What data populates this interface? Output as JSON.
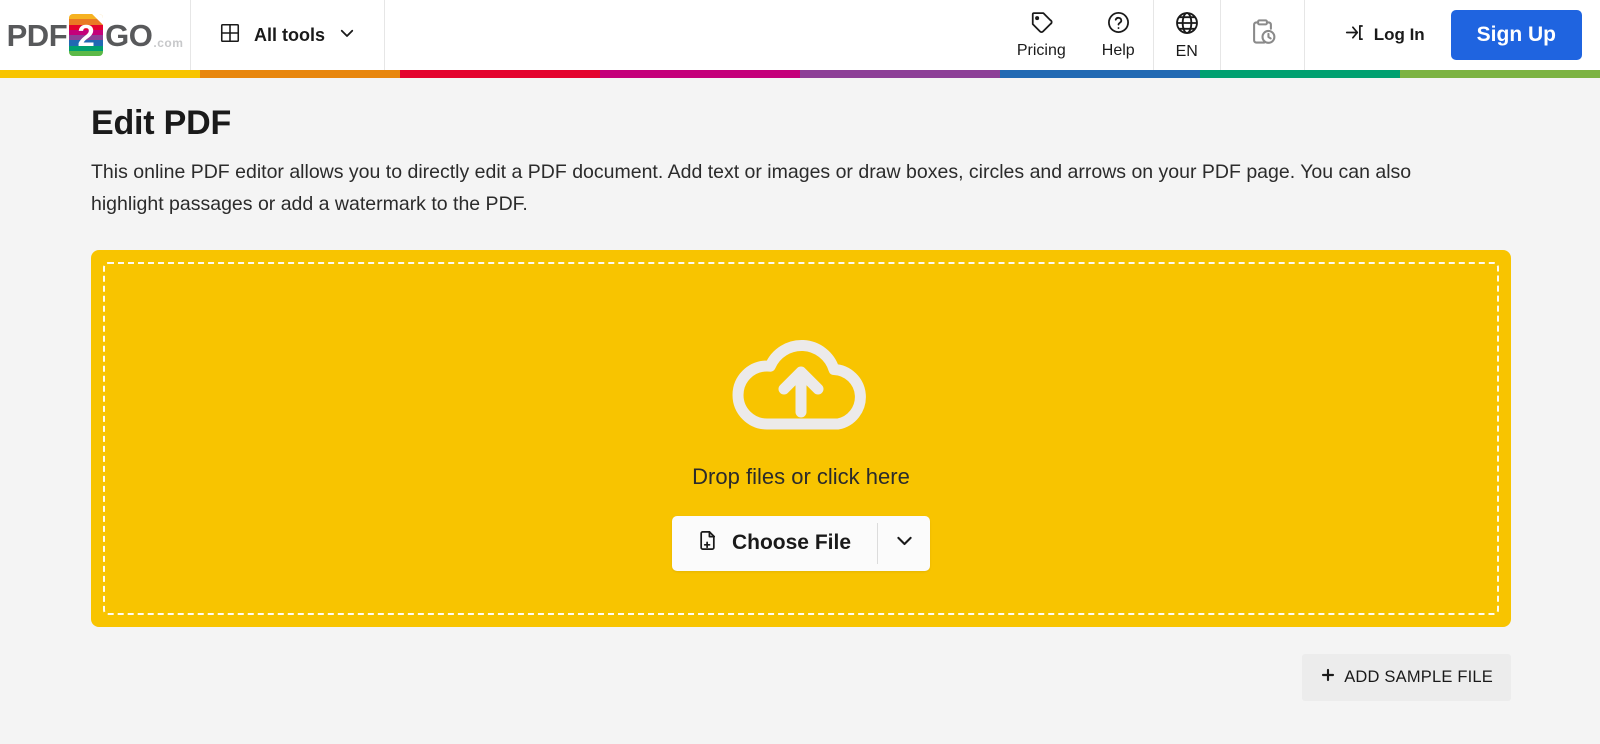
{
  "header": {
    "logo": {
      "part1": "PDF",
      "doc_char": "2",
      "part2": "GO",
      "suffix": ".com",
      "stripe_colors": [
        "#f6b221",
        "#ea7a23",
        "#e4032e",
        "#c4007a",
        "#8d3f97",
        "#2169b3",
        "#00a croppedplaceholder",
        "#5cb947"
      ]
    },
    "all_tools": {
      "label": "All tools",
      "icon": "grid-icon",
      "caret": "chevron-down-icon"
    },
    "nav": [
      {
        "label": "Pricing",
        "icon": "price-tag-icon"
      },
      {
        "label": "Help",
        "icon": "question-circle-icon"
      },
      {
        "label": "EN",
        "icon": "globe-icon"
      }
    ],
    "history_icon": "clipboard-clock-icon",
    "login": {
      "label": "Log In",
      "icon": "sign-in-icon"
    },
    "signup": {
      "label": "Sign Up"
    }
  },
  "colorbar": {
    "colors": [
      "#f8c400",
      "#e8860d",
      "#e4032e",
      "#c4007a",
      "#8d3f97",
      "#2169b3",
      "#00a070",
      "#7cb342"
    ]
  },
  "main": {
    "title": "Edit PDF",
    "description": "This online PDF editor allows you to directly edit a PDF document. Add text or images or draw boxes, circles and arrows on your PDF page. You can also highlight passages or add a watermark to the PDF.",
    "dropzone": {
      "icon": "cloud-upload-icon",
      "drop_label": "Drop files or click here",
      "choose_file_label": "Choose File",
      "choose_file_icon": "file-plus-icon",
      "caret_icon": "chevron-down-icon",
      "background_color": "#f8c400"
    },
    "sample_button": {
      "label": "ADD SAMPLE FILE",
      "icon": "plus-icon"
    }
  },
  "colors": {
    "accent_yellow": "#f8c400",
    "signup_blue": "#1f64e0",
    "page_background": "#f4f4f4"
  }
}
